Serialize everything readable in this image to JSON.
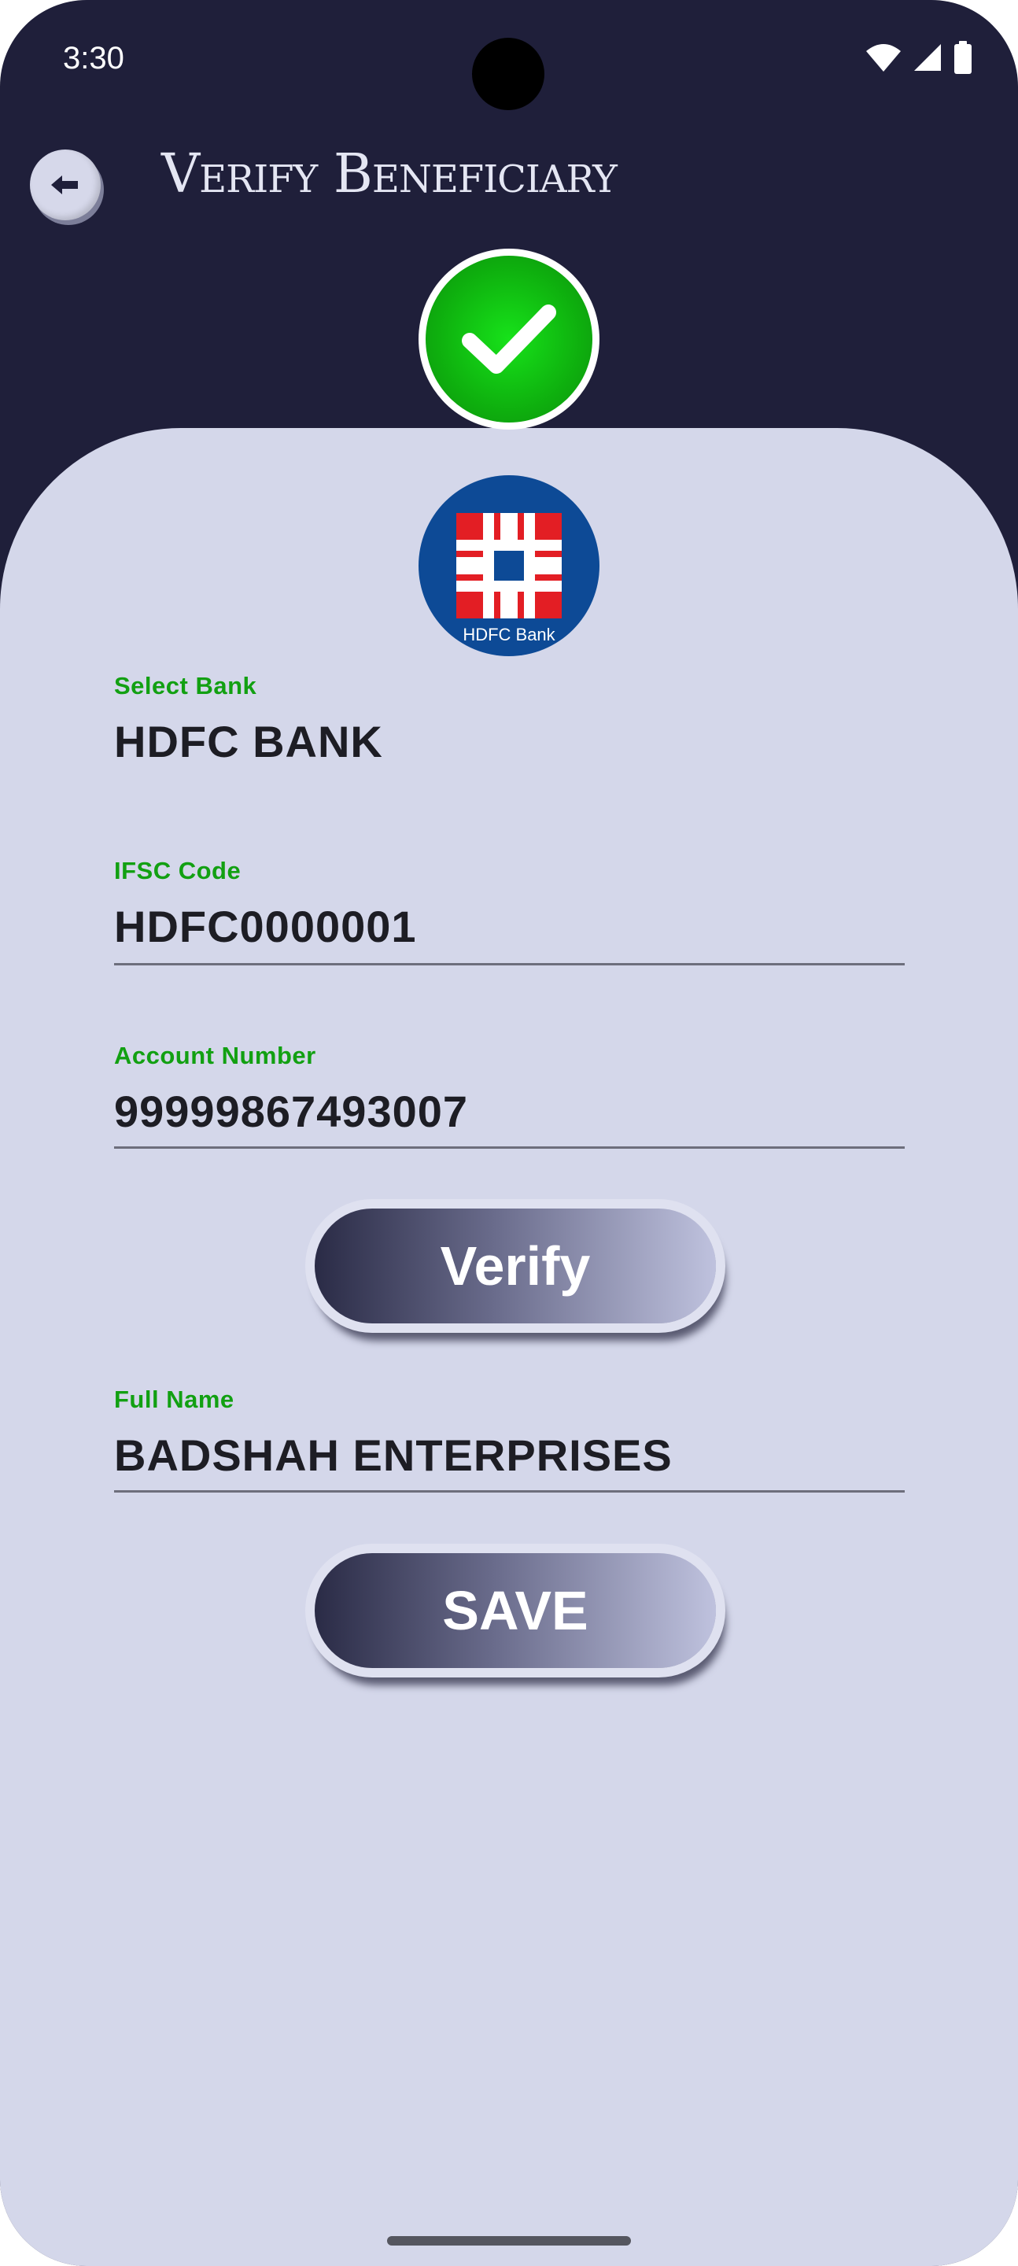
{
  "status_bar": {
    "time": "3:30"
  },
  "header": {
    "title": "Verify Beneficiary"
  },
  "bank_logo": {
    "text": "HDFC Bank"
  },
  "form": {
    "select_bank": {
      "label": "Select Bank",
      "value": "HDFC BANK"
    },
    "ifsc": {
      "label": "IFSC Code",
      "value": "HDFC0000001"
    },
    "account_number": {
      "label": "Account Number",
      "value": "99999867493007"
    },
    "verify_label": "Verify",
    "full_name": {
      "label": "Full Name",
      "value": "BADSHAH ENTERPRISES"
    },
    "save_label": "SAVE"
  },
  "colors": {
    "header_background": "#1f1f3a",
    "card_background": "#d4d7ea",
    "label_green": "#12a012",
    "success_green": "#0fb40f",
    "hdfc_blue": "#0d4a96",
    "hdfc_red": "#e31e24"
  },
  "icons": {
    "back": "back-arrow-icon",
    "success": "checkmark-icon",
    "wifi": "wifi-icon",
    "signal": "signal-icon",
    "battery": "battery-icon"
  }
}
